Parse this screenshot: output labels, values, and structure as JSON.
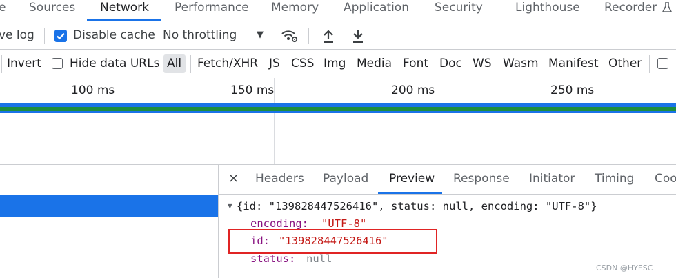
{
  "tabs": [
    {
      "label": "e"
    },
    {
      "label": "Sources"
    },
    {
      "label": "Network"
    },
    {
      "label": "Performance"
    },
    {
      "label": "Memory"
    },
    {
      "label": "Application"
    },
    {
      "label": "Security"
    },
    {
      "label": "Lighthouse"
    },
    {
      "label": "Recorder"
    }
  ],
  "recorder_icon": "flask-icon",
  "toolbar": {
    "preserve_log": "ve log",
    "disable_cache": "Disable cache",
    "disable_cache_checked": true,
    "throttling": "No throttling",
    "dropdown_glyph": "▼",
    "icons": [
      "wifi-settings-icon",
      "upload-icon",
      "download-icon"
    ]
  },
  "filters": {
    "invert": "Invert",
    "hide_data_urls": "Hide data URLs",
    "types": [
      "All",
      "Fetch/XHR",
      "JS",
      "CSS",
      "Img",
      "Media",
      "Font",
      "Doc",
      "WS",
      "Wasm",
      "Manifest",
      "Other"
    ]
  },
  "timeline": {
    "ticks": [
      "100 ms",
      "150 ms",
      "200 ms",
      "250 ms"
    ],
    "colors": {
      "blue": "#1a73e8",
      "green": "#1e8e3e"
    }
  },
  "detail": {
    "close": "×",
    "tabs": [
      "Headers",
      "Payload",
      "Preview",
      "Response",
      "Initiator",
      "Timing",
      "Coo"
    ],
    "active_tab": "Preview"
  },
  "preview": {
    "arrow": "▼",
    "summary": "{id: \"139828447526416\", status: null, encoding: \"UTF-8\"}",
    "encoding_key": "encoding:",
    "encoding_val": "\"UTF-8\"",
    "id_key": "id:",
    "id_val": "\"139828447526416\"",
    "status_key": "status:",
    "status_val": "null"
  },
  "watermark": "CSDN @HYESC",
  "accent_color": "#1a73e8",
  "highlight_color": "#e02424"
}
